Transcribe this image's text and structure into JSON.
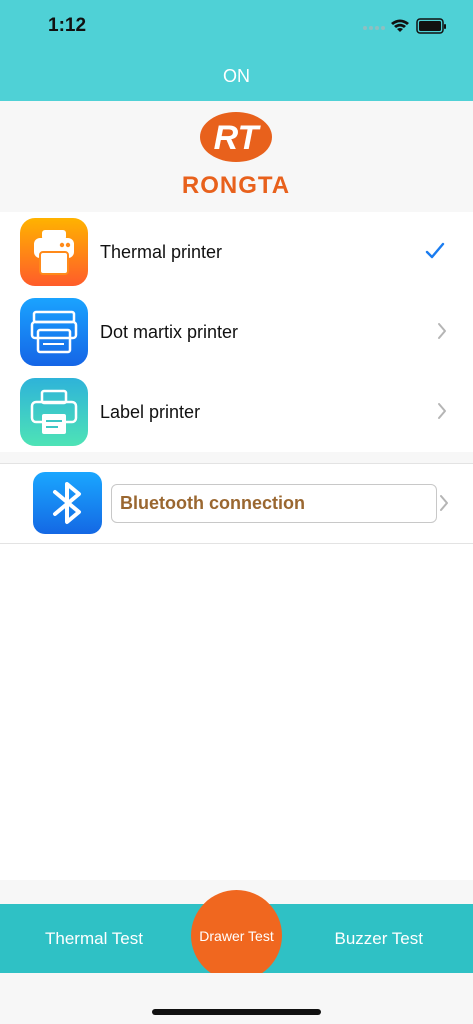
{
  "status_bar": {
    "time": "1:12"
  },
  "nav": {
    "title": "ON"
  },
  "logo": {
    "monogram": "RT",
    "brand": "RONGTA"
  },
  "printers": [
    {
      "label": "Thermal printer",
      "icon": "thermal-printer-icon",
      "selected": true
    },
    {
      "label": "Dot martix printer",
      "icon": "dot-matrix-printer-icon",
      "selected": false
    },
    {
      "label": "Label printer",
      "icon": "label-printer-icon",
      "selected": false
    }
  ],
  "bluetooth": {
    "value": "Bluetooth connection",
    "icon": "bluetooth-icon"
  },
  "tabs": {
    "left": "Thermal Test",
    "center": "Drawer Test",
    "right": "Buzzer Test"
  },
  "colors": {
    "header": "#4fd1d6",
    "tab_bar": "#2fc1c5",
    "accent_orange": "#f0671f",
    "checkmark": "#1a7cf0",
    "bluetooth_text": "#9a6730"
  }
}
